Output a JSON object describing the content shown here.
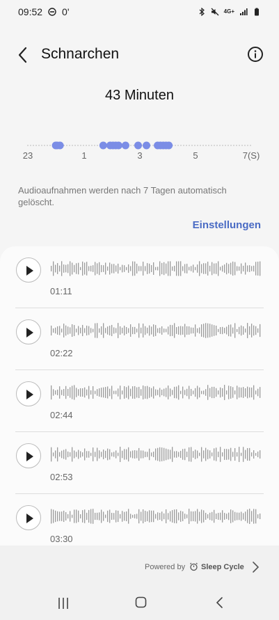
{
  "status_bar": {
    "time": "09:52",
    "icons": [
      "do-not-disturb-icon",
      "bluetooth-icon",
      "mute-icon",
      "4g-icon",
      "signal-icon",
      "battery-icon"
    ],
    "extra": "0'",
    "network": "4G+"
  },
  "header": {
    "title": "Schnarchen",
    "back_icon": "chevron-left-icon",
    "info_icon": "info-icon"
  },
  "summary": {
    "minutes_label": "43 Minuten",
    "timeline_ticks": [
      "23",
      "1",
      "3",
      "5",
      "7(S)"
    ],
    "events": [
      1.0,
      1.05,
      1.15,
      2.7,
      2.95,
      3.05,
      3.15,
      3.25,
      3.5,
      3.95,
      4.25,
      4.65,
      4.75,
      4.85,
      4.95,
      5.05
    ]
  },
  "info_text": "Audioaufnahmen werden nach 7 Tagen automatisch gelöscht.",
  "settings_link": "Einstellungen",
  "recordings": [
    {
      "time": "01:11",
      "seed": 3
    },
    {
      "time": "02:22",
      "seed": 7
    },
    {
      "time": "02:44",
      "seed": 11
    },
    {
      "time": "02:53",
      "seed": 17
    },
    {
      "time": "03:30",
      "seed": 23
    }
  ],
  "footer": {
    "powered_by": "Powered by",
    "brand": "Sleep Cycle"
  },
  "colors": {
    "accent": "#4a6bc4",
    "event_dot": "#7b8de6",
    "wave": "#9a9a9a"
  }
}
